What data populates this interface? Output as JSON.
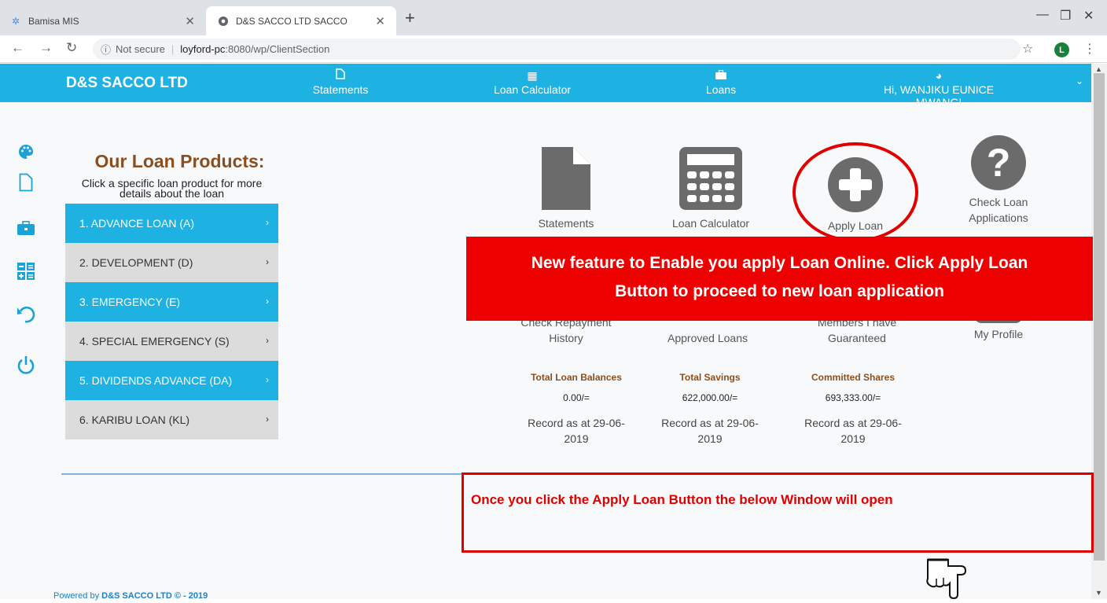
{
  "browser": {
    "tabs": [
      {
        "title": "Bamisa MIS",
        "icon": "mis-favicon"
      },
      {
        "title": "D&S SACCO LTD SACCO",
        "icon": "globe-favicon",
        "active": true
      }
    ],
    "address": {
      "security": "Not secure",
      "host": "loyford-pc",
      "path": ":8080/wp/ClientSection"
    },
    "profile_initial": "L"
  },
  "appnav": {
    "brand": "D&S SACCO LTD",
    "items": [
      {
        "label": "Statements",
        "icon": "document-icon"
      },
      {
        "label": "Loan Calculator",
        "icon": "calculator-icon"
      },
      {
        "label": "Loans",
        "icon": "briefcase-icon"
      },
      {
        "label": "Hi, WANJIKU EUNICE MWANGI",
        "icon": "dashboard-icon"
      }
    ]
  },
  "products": {
    "title": "Our Loan Products:",
    "subtitle_line1": "Click a specific loan product for more",
    "subtitle_line2": "details about the loan",
    "items": [
      {
        "label": "1. ADVANCE LOAN (A)",
        "style": "blue"
      },
      {
        "label": "2. DEVELOPMENT (D)",
        "style": "grey"
      },
      {
        "label": "3. EMERGENCY (E)",
        "style": "blue"
      },
      {
        "label": "4. SPECIAL EMERGENCY (S)",
        "style": "grey"
      },
      {
        "label": "5. DIVIDENDS ADVANCE (DA)",
        "style": "blue"
      },
      {
        "label": "6. KARIBU LOAN (KL)",
        "style": "grey"
      }
    ]
  },
  "tiles": {
    "statements": "Statements",
    "calculator": "Loan Calculator",
    "apply": "Apply Loan",
    "check_line1": "Check Loan",
    "check_line2": "Applications",
    "repay_line1": "Check Repayment",
    "repay_line2": "History",
    "approved": "Approved Loans",
    "guarantee_line1": "Members I have",
    "guarantee_line2": "Guaranteed",
    "profile": "My Profile"
  },
  "stats": [
    {
      "label": "Total Loan Balances",
      "value": "0.00/=",
      "record1": "Record as at 29-06-",
      "record2": "2019"
    },
    {
      "label": "Total Savings",
      "value": "622,000.00/=",
      "record1": "Record as at 29-06-",
      "record2": "2019"
    },
    {
      "label": "Committed Shares",
      "value": "693,333.00/=",
      "record1": "Record as at 29-06-",
      "record2": "2019"
    }
  ],
  "annotations": {
    "banner_line1": "New feature to Enable you apply Loan Online. Click Apply Loan",
    "banner_line2": "Button to proceed to  new loan application",
    "callout": "Once you click the Apply Loan Button the below Window will open"
  },
  "footer": {
    "prefix": "Powered by ",
    "brand": "D&S SACCO LTD © - 2019"
  },
  "colors": {
    "nav": "#1eb2e2",
    "accent_brown": "#8b4f1f",
    "annotation_red": "#ee0000"
  }
}
